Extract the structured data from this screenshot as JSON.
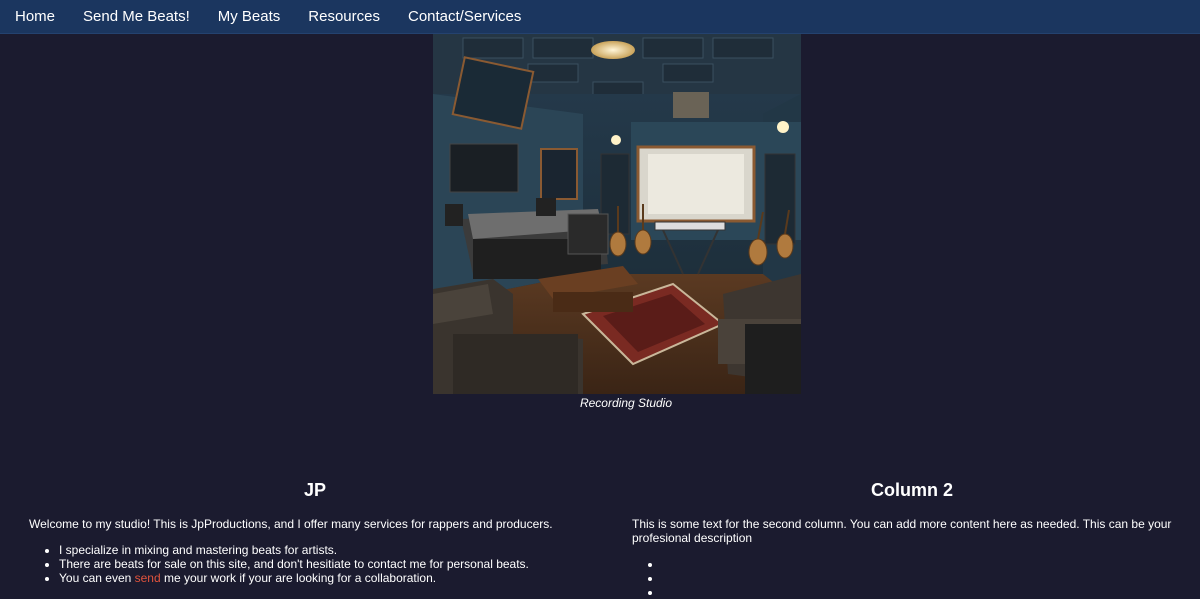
{
  "nav": {
    "items": [
      {
        "label": "Home"
      },
      {
        "label": "Send Me Beats!"
      },
      {
        "label": "My Beats"
      },
      {
        "label": "Resources"
      },
      {
        "label": "Contact/Services"
      }
    ]
  },
  "hero": {
    "caption": "Recording Studio"
  },
  "column1": {
    "title": "JP",
    "intro": "Welcome to my studio! This is JpProductions, and I offer many services for rappers and producers.",
    "bullets": [
      "I specialize in mixing and mastering beats for artists.",
      "There are beats for sale on this site, and don't hesitiate to contact me for personal beats."
    ],
    "bullet3_pre": "You can even ",
    "bullet3_link": "send",
    "bullet3_post": " me your work if your are looking for a collaboration."
  },
  "column2": {
    "title": "Column 2",
    "intro": "This is some text for the second column. You can add more content here as needed. This can be your profesional description"
  },
  "colors": {
    "background": "#1b1b2f",
    "navbar": "#1b365f",
    "link_accent": "#e0533d"
  }
}
